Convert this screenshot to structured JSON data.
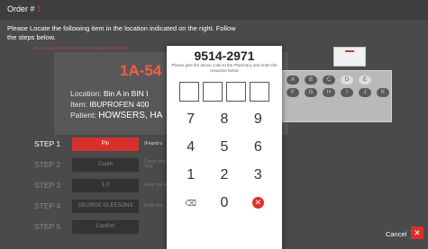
{
  "order": {
    "label": "Order #",
    "number": "1"
  },
  "instructions": "Please Locate the following item in the location indicated on the right. Follow the steps below.",
  "warning": "Do not remove the item from its packaging until after",
  "bin_code": "1A-54",
  "location": {
    "location_label": "Location:",
    "location_value": "Bin A in BIN I",
    "item_label": "Item:",
    "item_value": "IBUPROFEN 400",
    "patient_label": "Patient:",
    "patient_value": "HOWSERS, HA"
  },
  "cabinet": {
    "row1": [
      "A",
      "B",
      "C",
      "D",
      "E"
    ],
    "row2": [
      "F",
      "G",
      "H",
      "I",
      "J",
      "K"
    ]
  },
  "steps": [
    {
      "label": "STEP 1",
      "button": "Pin",
      "hint": "(Found o"
    },
    {
      "label": "STEP 2",
      "button": "Count",
      "hint": "Count remaining FROM THE"
    },
    {
      "label": "STEP 3",
      "button": "1.0",
      "hint": "Enter the remaining"
    },
    {
      "label": "STEP 4",
      "button": "GEORGE GLEESONS",
      "hint": "Enter the"
    },
    {
      "label": "STEP 5",
      "button": "Confirm",
      "hint": ""
    }
  ],
  "keypad": {
    "code": "9514-2971",
    "hint": "Please give the above code to the Pharmacy and enter the response below",
    "keys": [
      "7",
      "8",
      "9",
      "4",
      "5",
      "6",
      "1",
      "2",
      "3"
    ],
    "backspace": "⌫",
    "zero": "0",
    "clear": "✕"
  },
  "cancel": {
    "label": "Cancel",
    "icon": "✕"
  },
  "colors": {
    "accent": "#d8302c",
    "background": "#4a4a4a"
  }
}
